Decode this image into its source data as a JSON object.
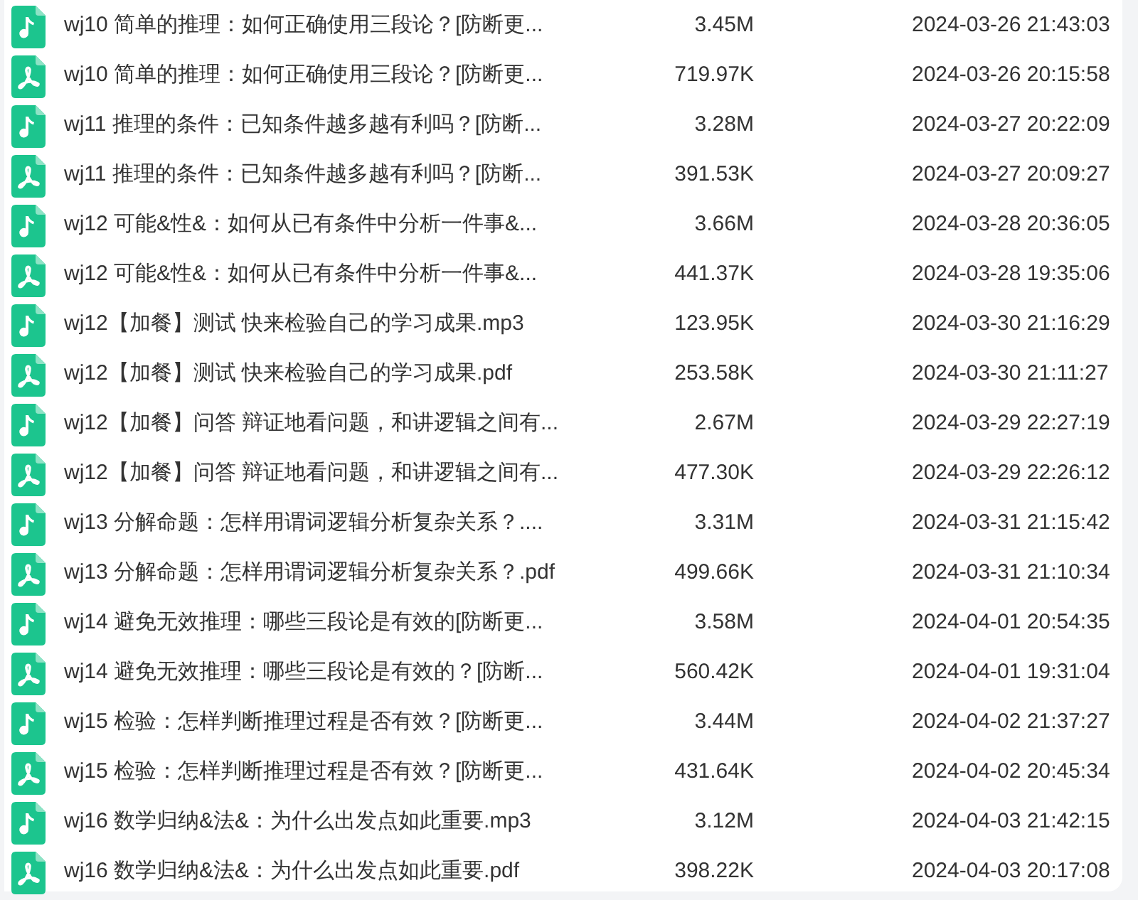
{
  "files": [
    {
      "kind": "audio",
      "name": "wj10 简单的推理：如何正确使用三段论？[防断更...",
      "size": "3.45M",
      "modified": "2024-03-26 21:43:03"
    },
    {
      "kind": "pdf",
      "name": "wj10 简单的推理：如何正确使用三段论？[防断更...",
      "size": "719.97K",
      "modified": "2024-03-26 20:15:58"
    },
    {
      "kind": "audio",
      "name": "wj11 推理的条件：已知条件越多越有利吗？[防断...",
      "size": "3.28M",
      "modified": "2024-03-27 20:22:09"
    },
    {
      "kind": "pdf",
      "name": "wj11 推理的条件：已知条件越多越有利吗？[防断...",
      "size": "391.53K",
      "modified": "2024-03-27 20:09:27"
    },
    {
      "kind": "audio",
      "name": "wj12 可能&性&：如何从已有条件中分析一件事&...",
      "size": "3.66M",
      "modified": "2024-03-28 20:36:05"
    },
    {
      "kind": "pdf",
      "name": "wj12 可能&性&：如何从已有条件中分析一件事&...",
      "size": "441.37K",
      "modified": "2024-03-28 19:35:06"
    },
    {
      "kind": "audio",
      "name": "wj12【加餐】测试 快来检验自己的学习成果.mp3",
      "size": "123.95K",
      "modified": "2024-03-30 21:16:29"
    },
    {
      "kind": "pdf",
      "name": "wj12【加餐】测试 快来检验自己的学习成果.pdf",
      "size": "253.58K",
      "modified": "2024-03-30 21:11:27"
    },
    {
      "kind": "audio",
      "name": "wj12【加餐】问答 辩证地看问题，和讲逻辑之间有...",
      "size": "2.67M",
      "modified": "2024-03-29 22:27:19"
    },
    {
      "kind": "pdf",
      "name": "wj12【加餐】问答 辩证地看问题，和讲逻辑之间有...",
      "size": "477.30K",
      "modified": "2024-03-29 22:26:12"
    },
    {
      "kind": "audio",
      "name": "wj13 分解命题：怎样用谓词逻辑分析复杂关系？....",
      "size": "3.31M",
      "modified": "2024-03-31 21:15:42"
    },
    {
      "kind": "pdf",
      "name": "wj13 分解命题：怎样用谓词逻辑分析复杂关系？.pdf",
      "size": "499.66K",
      "modified": "2024-03-31 21:10:34"
    },
    {
      "kind": "audio",
      "name": "wj14 避免无效推理：哪些三段论是有效的[防断更...",
      "size": "3.58M",
      "modified": "2024-04-01 20:54:35"
    },
    {
      "kind": "pdf",
      "name": "wj14 避免无效推理：哪些三段论是有效的？[防断...",
      "size": "560.42K",
      "modified": "2024-04-01 19:31:04"
    },
    {
      "kind": "audio",
      "name": "wj15 检验：怎样判断推理过程是否有效？[防断更...",
      "size": "3.44M",
      "modified": "2024-04-02 21:37:27"
    },
    {
      "kind": "pdf",
      "name": "wj15 检验：怎样判断推理过程是否有效？[防断更...",
      "size": "431.64K",
      "modified": "2024-04-02 20:45:34"
    },
    {
      "kind": "audio",
      "name": "wj16 数学归纳&法&：为什么出发点如此重要.mp3",
      "size": "3.12M",
      "modified": "2024-04-03 21:42:15"
    },
    {
      "kind": "pdf",
      "name": "wj16 数学归纳&法&：为什么出发点如此重要.pdf",
      "size": "398.22K",
      "modified": "2024-04-03 20:17:08"
    }
  ]
}
